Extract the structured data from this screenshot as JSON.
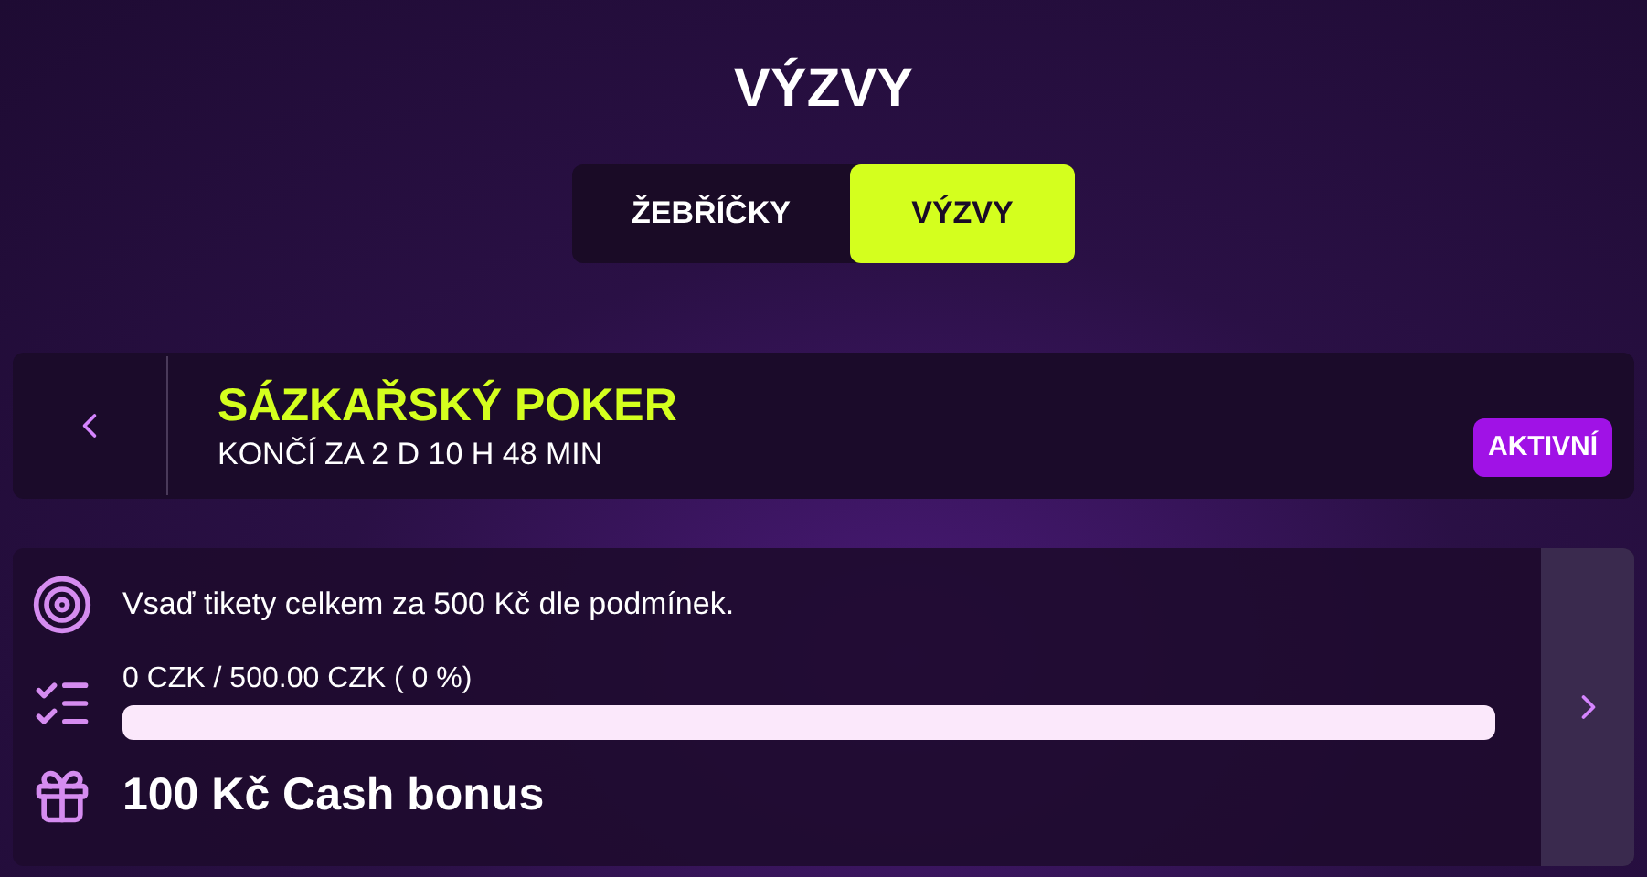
{
  "page_title": "VÝZVY",
  "tabs": [
    {
      "label": "ŽEBŘÍČKY",
      "selected": false
    },
    {
      "label": "VÝZVY",
      "selected": true
    }
  ],
  "challenge_header": {
    "name": "SÁZKAŘSKÝ POKER",
    "ends_in": "KONČÍ ZA 2 D 10 H 48 MIN",
    "status": "AKTIVNÍ"
  },
  "challenge": {
    "task": "Vsaď tikety celkem za 500 Kč dle podmínek.",
    "progress_text": "0 CZK / 500.00 CZK ( 0 %)",
    "level": 0,
    "reward": "100 Kč Cash bonus"
  }
}
